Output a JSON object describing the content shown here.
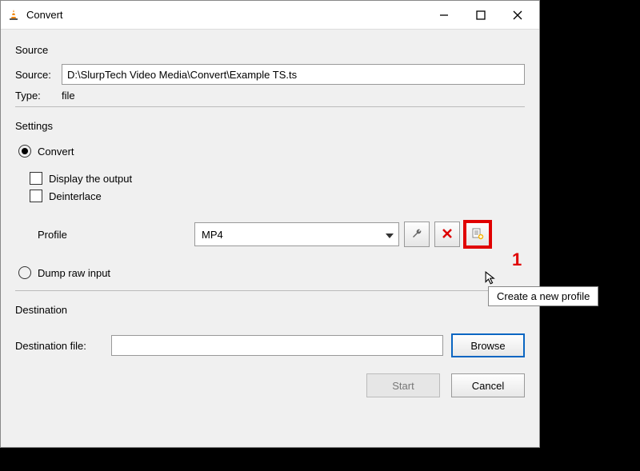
{
  "window": {
    "title": "Convert"
  },
  "source": {
    "section": "Source",
    "sourceLabel": "Source:",
    "sourceValue": "D:\\SlurpTech Video Media\\Convert\\Example TS.ts",
    "typeLabel": "Type:",
    "typeValue": "file"
  },
  "settings": {
    "section": "Settings",
    "convert": "Convert",
    "displayOutput": "Display the output",
    "deinterlace": "Deinterlace",
    "profileLabel": "Profile",
    "profileSelected": "MP4",
    "dumpRaw": "Dump raw input"
  },
  "tooltip": "Create a new profile",
  "annotation": "1",
  "destination": {
    "section": "Destination",
    "label": "Destination file:",
    "value": "",
    "browse": "Browse"
  },
  "buttons": {
    "start": "Start",
    "cancel": "Cancel"
  },
  "icons": {
    "wrench": "wrench-icon",
    "delete": "delete-icon",
    "new": "new-profile-icon"
  }
}
